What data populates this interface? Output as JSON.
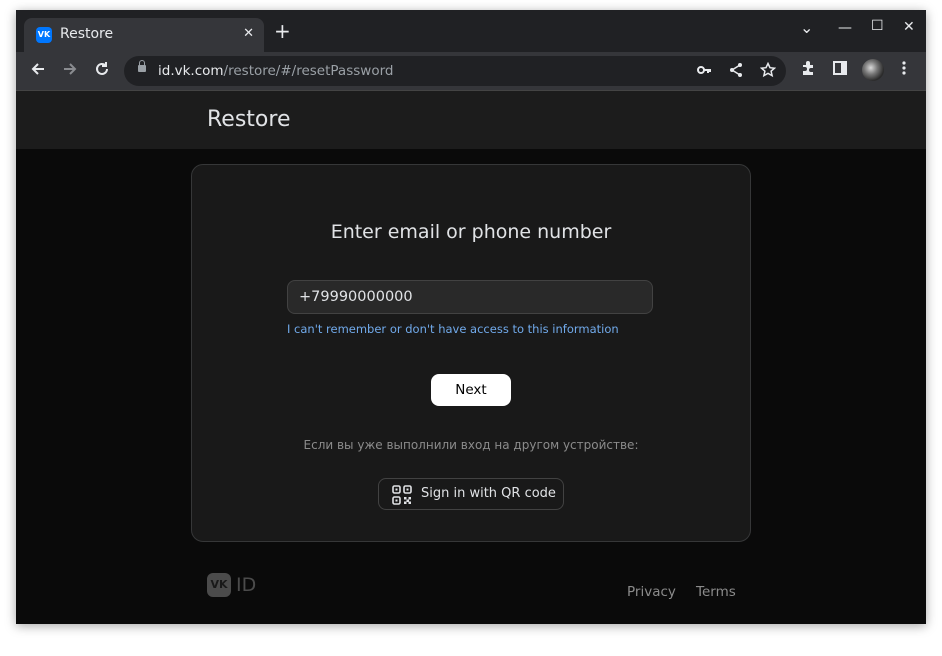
{
  "browser": {
    "tab": {
      "title": "Restore",
      "favicon_text": "VK",
      "close_glyph": "✕"
    },
    "new_tab_glyph": "+",
    "window_controls": {
      "dropdown": "⌄",
      "minimize": "—",
      "maximize": "☐",
      "close": "✕"
    },
    "address": {
      "host": "id.vk.com",
      "path": "/restore/#/resetPassword"
    }
  },
  "page": {
    "header_title": "Restore",
    "card": {
      "heading": "Enter email or phone number",
      "phone_value": "+79990000000",
      "help_link": "I can't remember or don't have access to this information",
      "next_button": "Next",
      "other_device_hint": "Если вы уже выполнили вход на другом устройстве:",
      "qr_button": "Sign in with QR code"
    },
    "footer": {
      "logo_mark": "VK",
      "logo_text": "ID",
      "links": [
        "Privacy",
        "Terms"
      ]
    }
  },
  "icons": [
    "back-icon",
    "forward-icon",
    "reload-icon",
    "lock-icon",
    "key-icon",
    "share-icon",
    "star-icon",
    "extensions-icon",
    "side-panel-icon",
    "menu-icon",
    "qr-code-icon"
  ],
  "colors": {
    "accent_link": "#71aaeb",
    "vk_blue": "#0077ff",
    "background": "#0a0a0a",
    "card": "#191919"
  }
}
